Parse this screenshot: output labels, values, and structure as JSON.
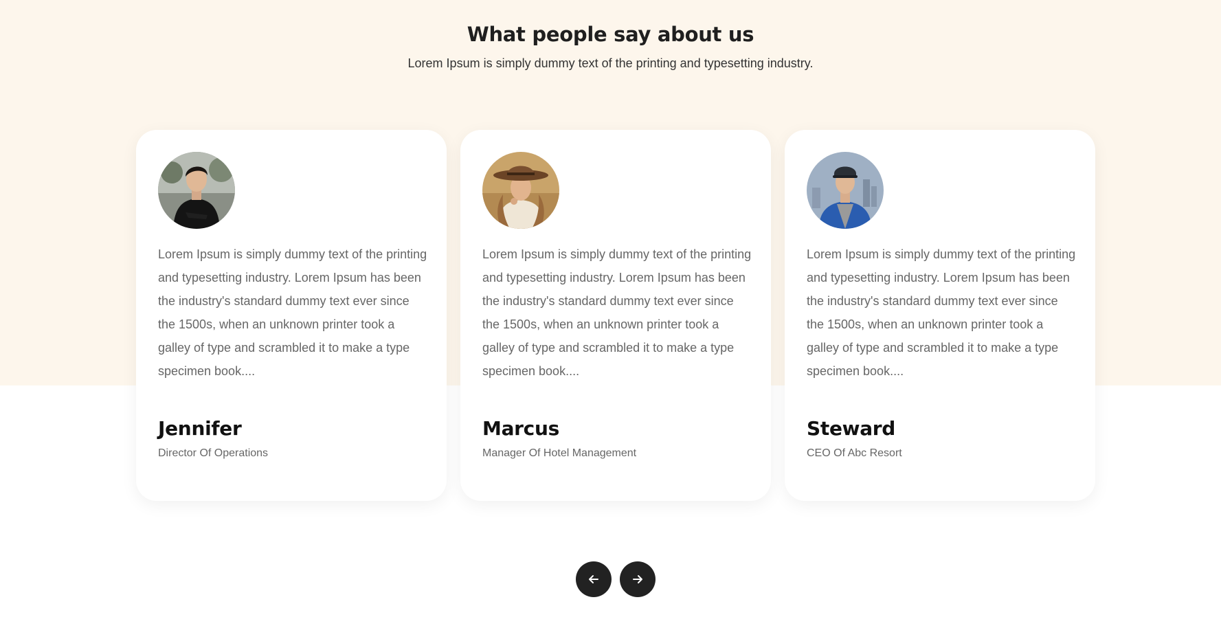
{
  "header": {
    "title": "What people say about us",
    "subtitle": "Lorem Ipsum is simply dummy text of the printing and typesetting industry."
  },
  "testimonials": [
    {
      "name": "Jennifer",
      "role": "Director Of Operations",
      "quote": "Lorem Ipsum is simply dummy text of the printing and typesetting industry. Lorem Ipsum has been the industry's standard dummy text ever since the 1500s, when an unknown printer took a galley of type and scrambled it to make a type specimen book....",
      "avatar_icon": "person-photo"
    },
    {
      "name": "Marcus",
      "role": "Manager Of Hotel Management",
      "quote": "Lorem Ipsum is simply dummy text of the printing and typesetting industry. Lorem Ipsum has been the industry's standard dummy text ever since the 1500s, when an unknown printer took a galley of type and scrambled it to make a type specimen book....",
      "avatar_icon": "person-photo"
    },
    {
      "name": "Steward",
      "role": "CEO Of Abc Resort",
      "quote": "Lorem Ipsum is simply dummy text of the printing and typesetting industry. Lorem Ipsum has been the industry's standard dummy text ever since the 1500s, when an unknown printer took a galley of type and scrambled it to make a type specimen book....",
      "avatar_icon": "person-photo"
    }
  ],
  "navigation": {
    "prev_icon": "arrow-left-icon",
    "next_icon": "arrow-right-icon"
  },
  "colors": {
    "top_band": "#fdf6ec",
    "card_bg": "#ffffff",
    "nav_button": "#222222",
    "text_muted": "#666666"
  }
}
